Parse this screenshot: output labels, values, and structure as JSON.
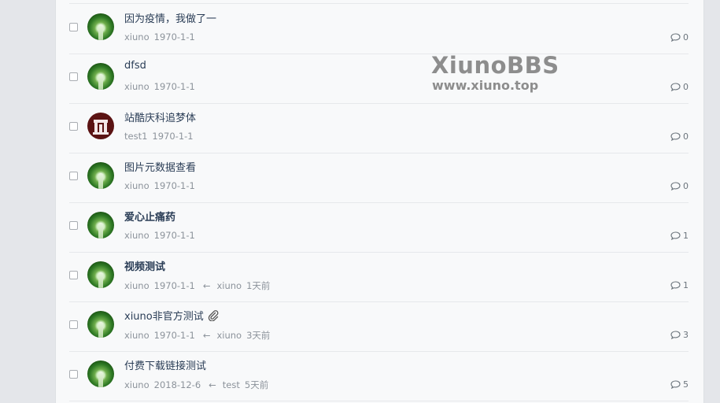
{
  "watermark": {
    "title": "XiunoBBS",
    "url": "www.xiuno.top"
  },
  "threads": [
    {
      "title": "因为疫情，我做了一",
      "bold": false,
      "author": "xiuno",
      "date": "1970-1-1",
      "last_user": "",
      "last_time": "",
      "replies": "0",
      "avatar_icon": "green-tree-avatar",
      "attachment": false
    },
    {
      "title": "dfsd",
      "bold": false,
      "author": "xiuno",
      "date": "1970-1-1",
      "last_user": "",
      "last_time": "",
      "replies": "0",
      "avatar_icon": "green-tree-avatar",
      "attachment": false
    },
    {
      "title": "站酷庆科追梦体",
      "bold": false,
      "author": "test1",
      "date": "1970-1-1",
      "last_user": "",
      "last_time": "",
      "replies": "0",
      "avatar_icon": "red-logo-avatar",
      "attachment": false
    },
    {
      "title": "图片元数据查看",
      "bold": false,
      "author": "xiuno",
      "date": "1970-1-1",
      "last_user": "",
      "last_time": "",
      "replies": "0",
      "avatar_icon": "green-tree-avatar",
      "attachment": false
    },
    {
      "title": "爱心止痛药",
      "bold": true,
      "author": "xiuno",
      "date": "1970-1-1",
      "last_user": "",
      "last_time": "",
      "replies": "1",
      "avatar_icon": "green-tree-avatar",
      "attachment": false
    },
    {
      "title": "视频测试",
      "bold": true,
      "author": "xiuno",
      "date": "1970-1-1",
      "last_user": "xiuno",
      "last_time": "1天前",
      "replies": "1",
      "avatar_icon": "green-tree-avatar",
      "attachment": false
    },
    {
      "title": "xiuno非官方测试",
      "bold": false,
      "author": "xiuno",
      "date": "1970-1-1",
      "last_user": "xiuno",
      "last_time": "3天前",
      "replies": "3",
      "avatar_icon": "green-tree-avatar",
      "attachment": true
    },
    {
      "title": "付费下载链接测试",
      "bold": false,
      "author": "xiuno",
      "date": "2018-12-6",
      "last_user": "test",
      "last_time": "5天前",
      "replies": "5",
      "avatar_icon": "green-tree-avatar",
      "attachment": false
    }
  ],
  "reply_arrow": "←",
  "colors": {
    "title": "#2a3d56",
    "meta": "#8c939b",
    "watermark": "#8d8d8d",
    "card": "#f8f9fa",
    "background": "#e4e6ea"
  }
}
